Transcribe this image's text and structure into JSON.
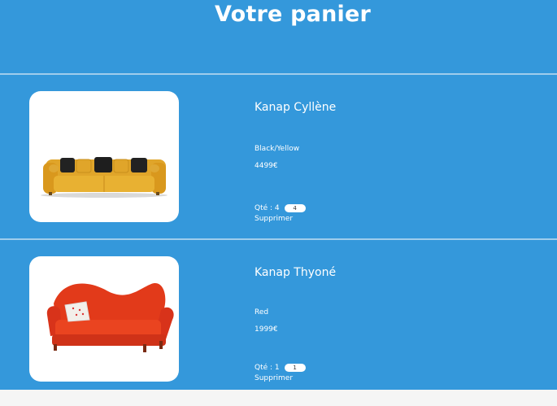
{
  "page": {
    "title": "Votre panier"
  },
  "cart": {
    "items": [
      {
        "name": "Kanap Cyllène",
        "color": "Black/Yellow",
        "price": "4499€",
        "qty_label": "Qté : 4",
        "qty_value": "4",
        "delete_label": "Supprimer",
        "image_icon": "yellow-sofa-icon"
      },
      {
        "name": "Kanap Thyoné",
        "color": "Red",
        "price": "1999€",
        "qty_label": "Qté : 1",
        "qty_value": "1",
        "delete_label": "Supprimer",
        "image_icon": "red-sofa-icon"
      }
    ]
  },
  "colors": {
    "background": "#3498db",
    "text": "#ffffff",
    "card": "#ffffff"
  }
}
